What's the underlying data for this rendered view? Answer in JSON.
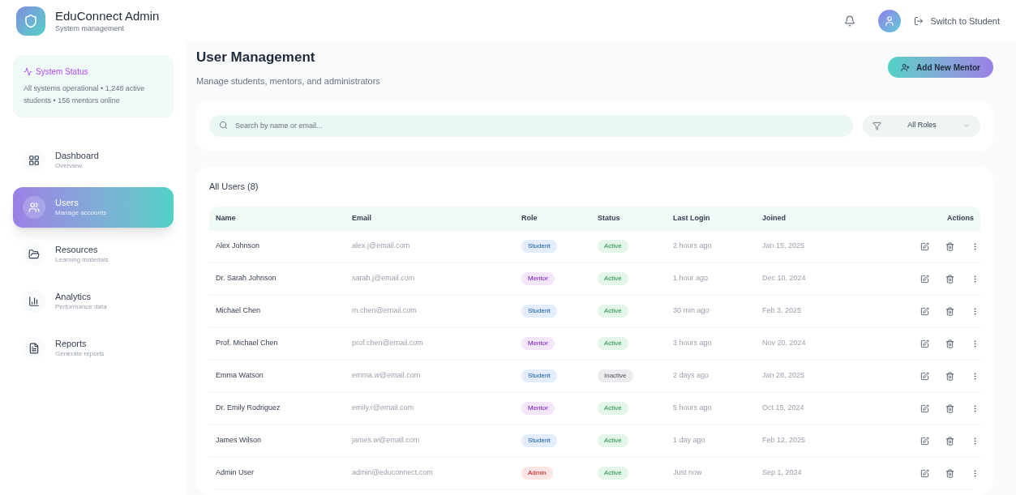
{
  "header": {
    "title": "EduConnect Admin",
    "subtitle": "System management",
    "switch_label": "Switch to Student"
  },
  "system_status": {
    "title": "System Status",
    "text": "All systems operational • 1,248 active students • 156 mentors online"
  },
  "nav": [
    {
      "kind": "dashboard",
      "label": "Dashboard",
      "sub": "Overview",
      "selected": false
    },
    {
      "kind": "users",
      "label": "Users",
      "sub": "Manage accounts",
      "selected": true
    },
    {
      "kind": "resources",
      "label": "Resources",
      "sub": "Learning materials",
      "selected": false
    },
    {
      "kind": "analytics",
      "label": "Analytics",
      "sub": "Performance data",
      "selected": false
    },
    {
      "kind": "reports",
      "label": "Reports",
      "sub": "Generate reports",
      "selected": false
    }
  ],
  "page": {
    "title": "User Management",
    "subtitle": "Manage students, mentors, and administrators",
    "add_button": "Add New Mentor"
  },
  "filters": {
    "search_placeholder": "Search by name or email...",
    "role_filter": "All Roles"
  },
  "table": {
    "title": "All Users (8)",
    "columns": [
      "Name",
      "Email",
      "Role",
      "Status",
      "Last Login",
      "Joined",
      "Actions"
    ],
    "rows": [
      {
        "name": "Alex Johnson",
        "email": "alex.j@email.com",
        "role": {
          "label": "Student",
          "color": "#e3edfd"
        },
        "status": {
          "label": "Active",
          "color": "#e3f7e9"
        },
        "last_login": "2 hours ago",
        "joined": "Jan 15, 2025"
      },
      {
        "name": "Dr. Sarah Johnson",
        "email": "sarah.j@email.com",
        "role": {
          "label": "Mentor",
          "color": "#f3e6fd"
        },
        "status": {
          "label": "Active",
          "color": "#e3f7e9"
        },
        "last_login": "1 hour ago",
        "joined": "Dec 10, 2024"
      },
      {
        "name": "Michael Chen",
        "email": "m.chen@email.com",
        "role": {
          "label": "Student",
          "color": "#e3edfd"
        },
        "status": {
          "label": "Active",
          "color": "#e3f7e9"
        },
        "last_login": "30 min ago",
        "joined": "Feb 3, 2025"
      },
      {
        "name": "Prof. Michael Chen",
        "email": "prof.chen@email.com",
        "role": {
          "label": "Mentor",
          "color": "#f3e6fd"
        },
        "status": {
          "label": "Active",
          "color": "#e3f7e9"
        },
        "last_login": "3 hours ago",
        "joined": "Nov 20, 2024"
      },
      {
        "name": "Emma Watson",
        "email": "emma.w@email.com",
        "role": {
          "label": "Student",
          "color": "#e3edfd"
        },
        "status": {
          "label": "Inactive",
          "color": "#ececee"
        },
        "last_login": "2 days ago",
        "joined": "Jan 28, 2025"
      },
      {
        "name": "Dr. Emily Rodriguez",
        "email": "emily.r@email.com",
        "role": {
          "label": "Mentor",
          "color": "#f3e6fd"
        },
        "status": {
          "label": "Active",
          "color": "#e3f7e9"
        },
        "last_login": "5 hours ago",
        "joined": "Oct 15, 2024"
      },
      {
        "name": "James Wilson",
        "email": "james.w@email.com",
        "role": {
          "label": "Student",
          "color": "#e3edfd"
        },
        "status": {
          "label": "Active",
          "color": "#e3f7e9"
        },
        "last_login": "1 day ago",
        "joined": "Feb 12, 2025"
      },
      {
        "name": "Admin User",
        "email": "admin@educonnect.com",
        "role": {
          "label": "Admin",
          "color": "#fde4e4"
        },
        "status": {
          "label": "Active",
          "color": "#e3f7e9"
        },
        "last_login": "Just now",
        "joined": "Sep 1, 2024"
      }
    ]
  }
}
